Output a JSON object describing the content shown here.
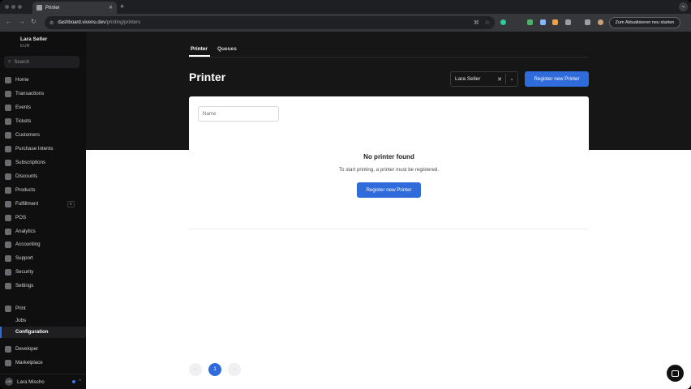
{
  "browser": {
    "tab_title": "Printer",
    "tab_close": "✕",
    "new_tab": "+",
    "url_host": "dashboard.vivenu.dev",
    "url_path": "/printing/printers",
    "update_button": "Zum Aktualisieren neu starten"
  },
  "sidebar": {
    "user_name": "Lara Seller",
    "currency": "EUR",
    "search_placeholder": "Search",
    "items": [
      {
        "label": "Home"
      },
      {
        "label": "Transactions"
      },
      {
        "label": "Events"
      },
      {
        "label": "Tickets"
      },
      {
        "label": "Customers"
      },
      {
        "label": "Purchase Intents"
      },
      {
        "label": "Subscriptions"
      },
      {
        "label": "Discounts"
      },
      {
        "label": "Products"
      },
      {
        "label": "Fulfillment",
        "badge": "E"
      },
      {
        "label": "POS"
      },
      {
        "label": "Analytics"
      },
      {
        "label": "Accounting"
      },
      {
        "label": "Support"
      },
      {
        "label": "Security"
      },
      {
        "label": "Settings"
      }
    ],
    "print_section": "Print",
    "print_sub": [
      "Jobs",
      "Configuration"
    ],
    "developer": "Developer",
    "marketplace": "Marketplace",
    "footer_user": "Lara Mischo",
    "footer_initials": "LM"
  },
  "main": {
    "tabs": [
      "Printer",
      "Queues"
    ],
    "title": "Printer",
    "owner_select_value": "Lara Seller",
    "register_button": "Register new Printer",
    "name_filter_placeholder": "Name",
    "empty_title": "No printer found",
    "empty_subtitle": "To start printing, a printer must be registered.",
    "empty_button": "Register new Printer",
    "pagination": {
      "current": "1",
      "prev": "←",
      "next": "→"
    }
  },
  "colors": {
    "accent": "#2f6bdb",
    "sidebar_bg": "#0f0f10",
    "content_bg": "#161617"
  }
}
